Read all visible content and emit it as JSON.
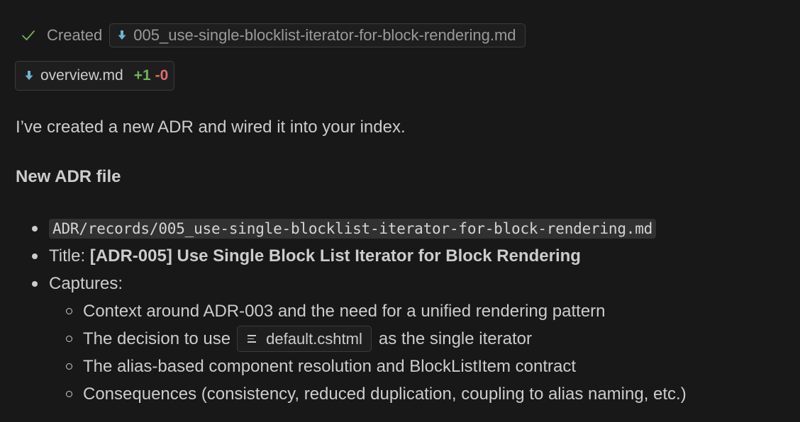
{
  "status": {
    "created_label": "Created",
    "created_file": "005_use-single-blocklist-iterator-for-block-rendering.md",
    "check_color": "#71b356",
    "md_icon_color": "#6fb3d2"
  },
  "changed_file": {
    "name": "overview.md",
    "added": "+1",
    "removed": "-0"
  },
  "message": {
    "intro": "I’ve created a new ADR and wired it into your index.",
    "heading": "New ADR file",
    "path": "ADR/records/005_use-single-blocklist-iterator-for-block-rendering.md",
    "title_label": "Title:",
    "title_value": "[ADR-005] Use Single Block List Iterator for Block Rendering",
    "captures_label": "Captures:",
    "captures": [
      "Context around ADR-003 and the need for a unified rendering pattern",
      {
        "before": "The decision to use",
        "file": "default.cshtml",
        "after": "as the single iterator"
      },
      "The alias-based component resolution and BlockListItem contract",
      "Consequences (consistency, reduced duplication, coupling to alias naming, etc.)"
    ]
  }
}
